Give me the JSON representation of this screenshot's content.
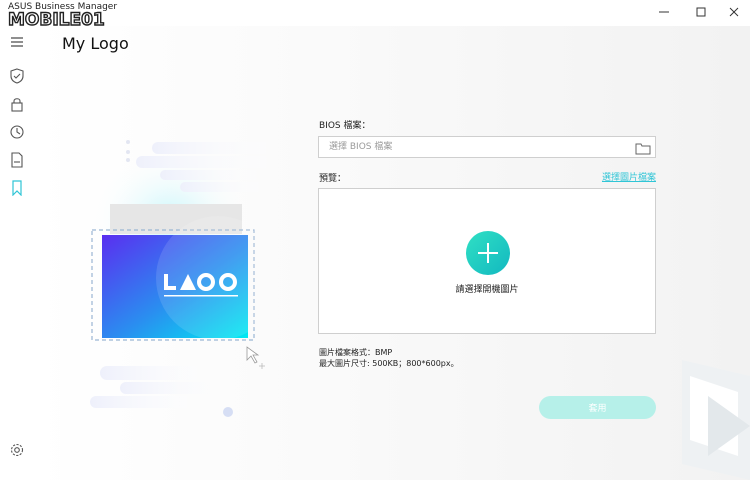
{
  "window": {
    "title": "ASUS Business Manager",
    "watermark_text": "MOBILE01",
    "minimize_icon": "minimize-icon",
    "maximize_icon": "maximize-icon",
    "close_icon": "close-icon"
  },
  "sidebar": {
    "items": [
      {
        "icon": "menu-icon"
      },
      {
        "icon": "shield-icon"
      },
      {
        "icon": "lock-icon"
      },
      {
        "icon": "history-icon"
      },
      {
        "icon": "document-icon"
      },
      {
        "icon": "bookmark-icon"
      }
    ],
    "settings_icon": "gear-icon"
  },
  "page": {
    "title": "My Logo"
  },
  "illustration": {
    "logo_text": "LOGO"
  },
  "form": {
    "bios_label": "BIOS 檔案：",
    "bios_placeholder": "選擇 BIOS 檔案",
    "preview_label": "預覽：",
    "select_image_link": "選擇圖片檔案",
    "add_caption": "請選擇開機圖片",
    "format_info": "圖片檔案格式：BMP",
    "size_info": "最大圖片尺寸: 500KB；800*600px。",
    "apply_label": "套用"
  },
  "colors": {
    "accent": "#1fc6c8",
    "link": "#30c5d6",
    "apply_disabled": "#b6f0e9",
    "sidebar_active": "#30c5d6"
  }
}
